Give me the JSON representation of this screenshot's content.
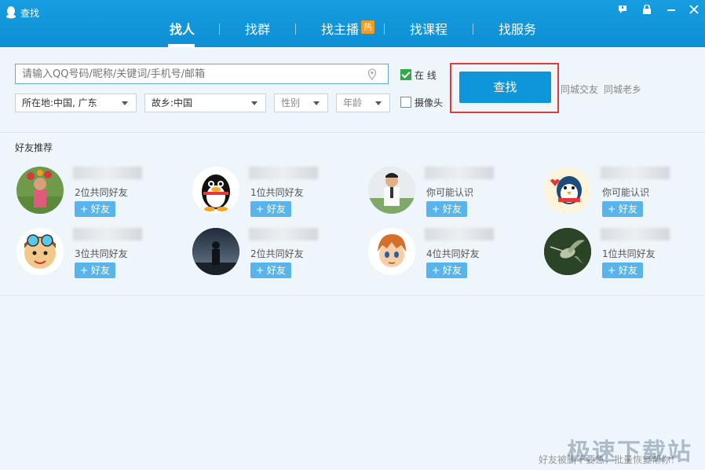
{
  "window": {
    "title": "查找"
  },
  "nav": {
    "tabs": [
      {
        "label": "找人"
      },
      {
        "label": "找群"
      },
      {
        "label": "找主播"
      },
      {
        "label": "找课程"
      },
      {
        "label": "找服务"
      }
    ],
    "hot_badge": "热",
    "active_index": 0
  },
  "search": {
    "placeholder": "请输入QQ号码/昵称/关键词/手机号/邮箱",
    "location": "所在地:中国, 广东",
    "hometown": "故乡:中国",
    "gender": "性别",
    "age": "年龄",
    "online_label": "在  线",
    "online_checked": true,
    "avatar_label": "摄像头",
    "avatar_checked": false,
    "button_label": "查找",
    "links": [
      "同城交友",
      "同城老乡"
    ]
  },
  "recommend": {
    "title": "好友推荐",
    "add_label": "+ 好友",
    "items": [
      {
        "desc": "2位共同好友",
        "avatar": "person-flowers"
      },
      {
        "desc": "1位共同好友",
        "avatar": "qq-penguin"
      },
      {
        "desc": "你可能认识",
        "avatar": "man-white-shirt"
      },
      {
        "desc": "你可能认识",
        "avatar": "penguin-scarf"
      },
      {
        "desc": "3位共同好友",
        "avatar": "cartoon-boy"
      },
      {
        "desc": "2位共同好友",
        "avatar": "night-silhouette"
      },
      {
        "desc": "4位共同好友",
        "avatar": "anime-boy"
      },
      {
        "desc": "1位共同好友",
        "avatar": "hummingbird"
      }
    ]
  },
  "footer": {
    "tip": "好友被删不要急，批量恢复帮你！"
  },
  "watermark": "极速下载站",
  "colors": {
    "accent": "#0f95da",
    "highlight": "#e53935",
    "add_button": "#5ab4ec"
  }
}
